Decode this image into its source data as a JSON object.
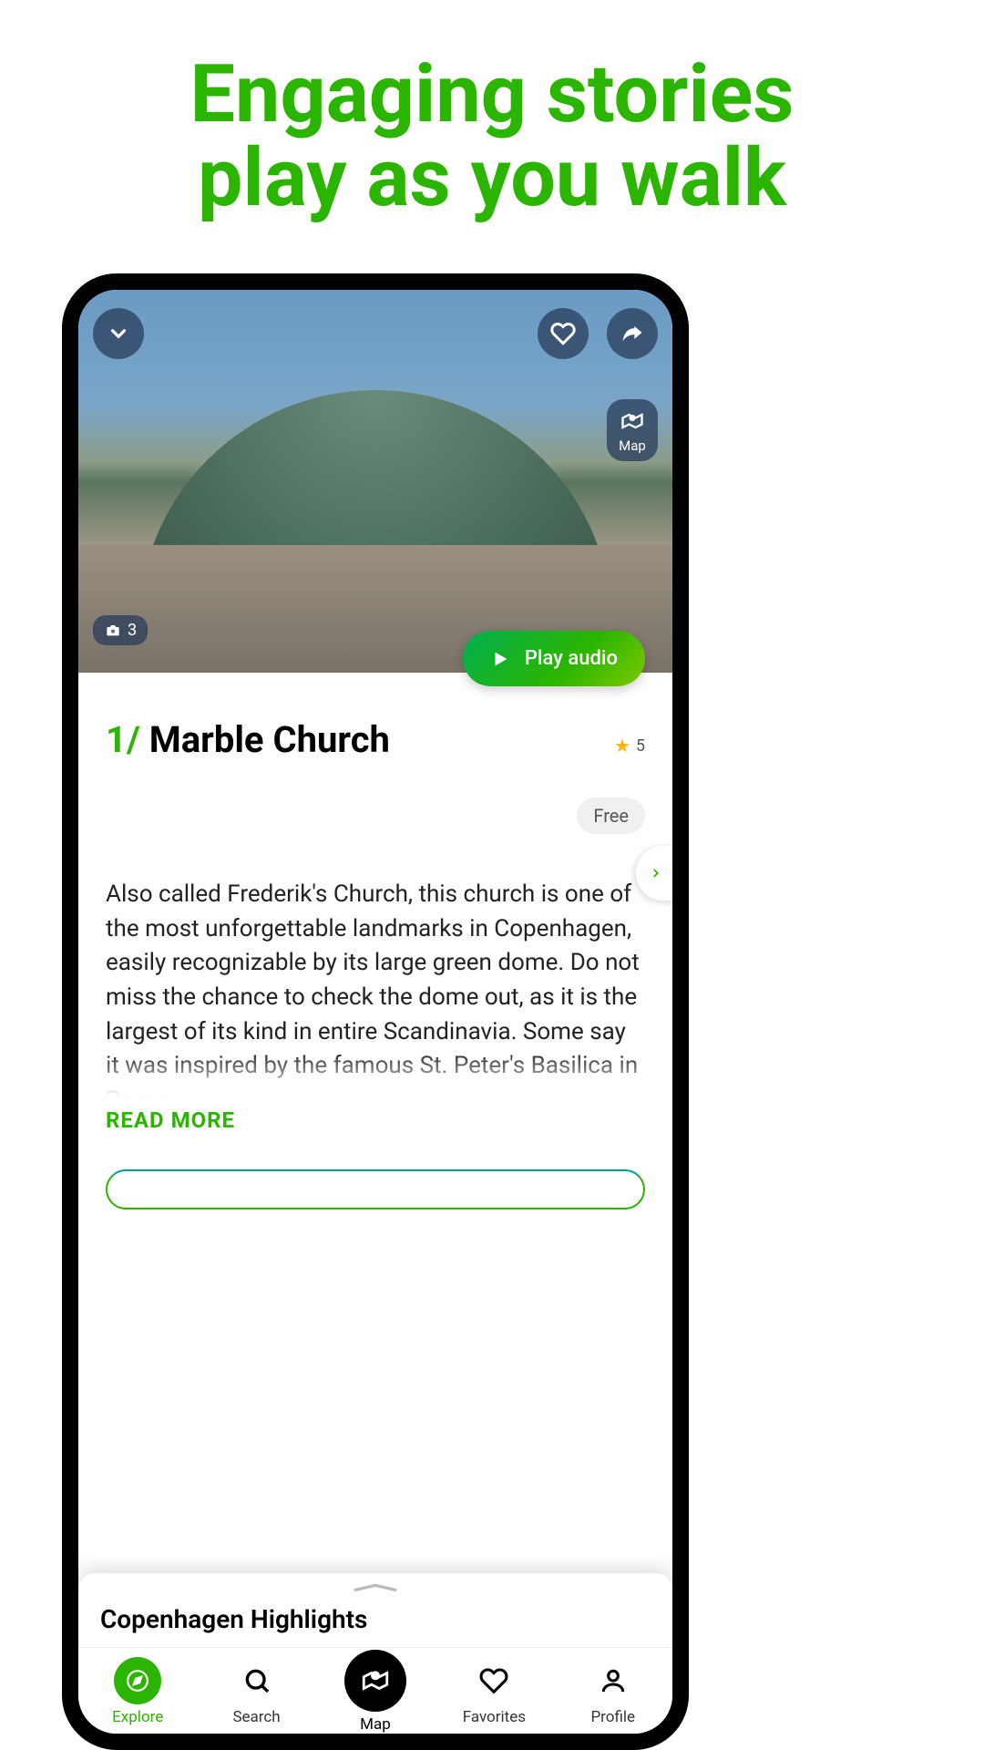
{
  "headline": {
    "line1": "Engaging stories",
    "line2": "play as you walk"
  },
  "hero": {
    "photo_count": "3",
    "map_chip_label": "Map"
  },
  "play_button_label": "Play audio",
  "poi": {
    "index": "1/",
    "title": "Marble Church",
    "rating": "5",
    "price_badge": "Free",
    "description": "Also called Frederik's Church, this church is one of the most unforgettable landmarks in Copenhagen, easily recognizable by its large green dome. Do not miss the chance to check the dome out, as it is the largest of its kind in entire Scandinavia. Some say it was inspired by the famous St. Peter's Basilica in Rome",
    "read_more_label": "READ MORE"
  },
  "bottom_sheet": {
    "title": "Copenhagen Highlights"
  },
  "nav": {
    "explore": "Explore",
    "search": "Search",
    "map": "Map",
    "favorites": "Favorites",
    "profile": "Profile"
  }
}
